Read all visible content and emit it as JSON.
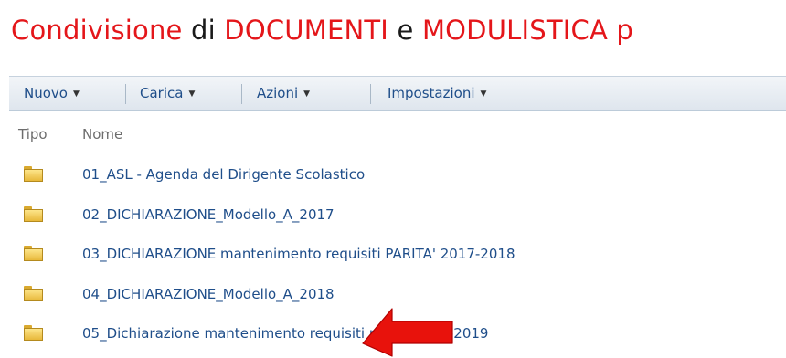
{
  "page": {
    "title_parts": [
      "Condivisione",
      " di ",
      "DOCUMENTI",
      " e ",
      "MODULISTICA",
      " p"
    ]
  },
  "toolbar": {
    "nuovo": "Nuovo",
    "carica": "Carica",
    "azioni": "Azioni",
    "impostazioni": "Impostazioni",
    "dropdown_glyph": "▼"
  },
  "list": {
    "headers": {
      "tipo": "Tipo",
      "nome": "Nome"
    },
    "items": [
      {
        "icon": "folder-icon",
        "name": "01_ASL - Agenda del Dirigente Scolastico"
      },
      {
        "icon": "folder-icon",
        "name": "02_DICHIARAZIONE_Modello_A_2017"
      },
      {
        "icon": "folder-icon",
        "name": "03_DICHIARAZIONE mantenimento requisiti PARITA' 2017-2018"
      },
      {
        "icon": "folder-icon",
        "name": "04_DICHIARAZIONE_Modello_A_2018"
      },
      {
        "icon": "folder-icon",
        "name": "05_Dichiarazione mantenimento requisiti parità 2018-2019"
      }
    ]
  },
  "annotation": {
    "icon": "red-arrow-icon",
    "color": "#e8120c"
  },
  "colors": {
    "title_red": "#e4161a",
    "link_blue": "#1f4e8a",
    "toolbar_bg": "#e6ecf2",
    "folder": "#f5cd58"
  }
}
